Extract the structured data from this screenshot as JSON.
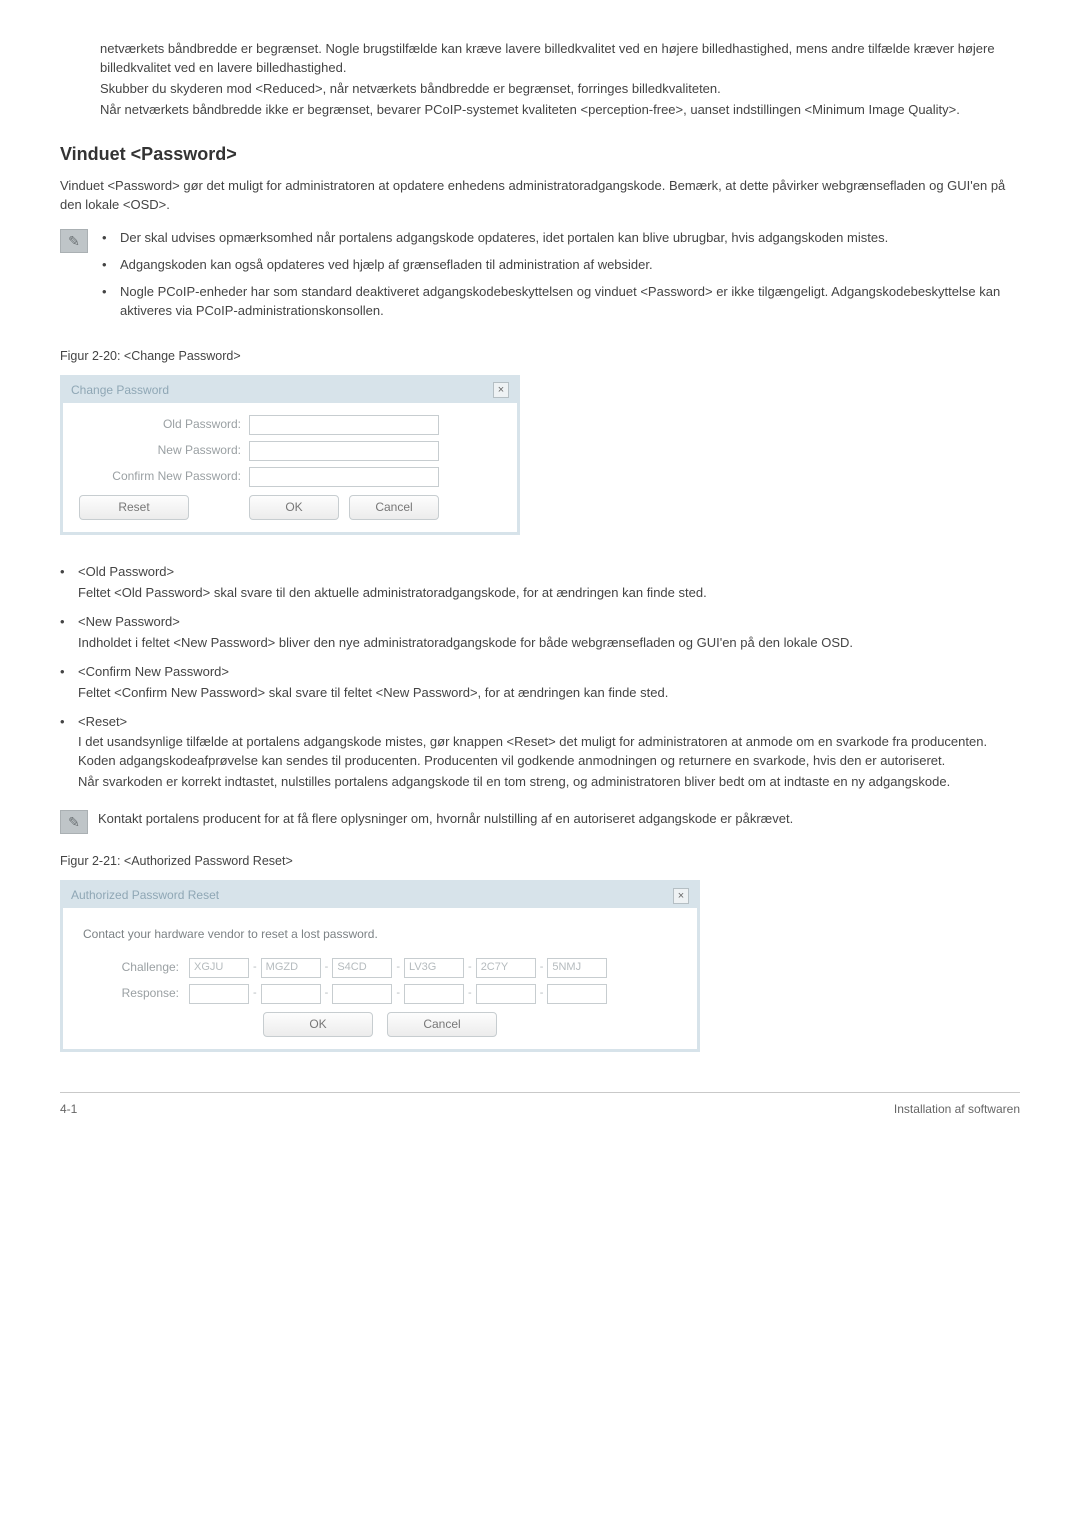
{
  "intro": {
    "p1": "netværkets båndbredde er begrænset. Nogle brugstilfælde kan kræve lavere billedkvalitet ved en højere billedhastighed, mens andre tilfælde kræver højere billedkvalitet ved en lavere billedhastighed.",
    "p2": "Skubber du skyderen mod <Reduced>, når netværkets båndbredde er begrænset, forringes billedkvaliteten.",
    "p3": "Når netværkets båndbredde ikke er begrænset, bevarer PCoIP-systemet kvaliteten <perception-free>, uanset indstillingen <Minimum Image Quality>."
  },
  "heading": "Vinduet <Password>",
  "section_intro": "Vinduet <Password> gør det muligt for administratoren at opdatere enhedens administratoradgangskode. Bemærk, at dette påvirker webgrænsefladen og GUI'en på den lokale <OSD>.",
  "notes": [
    "Der skal udvises opmærksomhed når portalens adgangskode opdateres, idet portalen kan blive ubrugbar, hvis adgangskoden mistes.",
    "Adgangskoden kan også opdateres ved hjælp af grænsefladen til administration af websider.",
    "Nogle PCoIP-enheder har som standard deaktiveret adgangskodebeskyttelsen og vinduet <Password> er ikke tilgængeligt. Adgangskodebeskyttelse kan aktiveres via PCoIP-administrationskonsollen."
  ],
  "fig220_caption": "Figur 2-20: <Change Password>",
  "change_pw_dialog": {
    "title": "Change Password",
    "close": "×",
    "labels": {
      "old": "Old Password:",
      "new": "New Password:",
      "confirm": "Confirm New Password:"
    },
    "buttons": {
      "reset": "Reset",
      "ok": "OK",
      "cancel": "Cancel"
    }
  },
  "desc": [
    {
      "term": "<Old Password>",
      "body": "Feltet <Old Password> skal svare til den aktuelle administratoradgangskode, for at ændringen kan finde sted."
    },
    {
      "term": "<New Password>",
      "body": "Indholdet i feltet <New Password> bliver den nye administratoradgangskode for både webgrænsefladen og GUI'en på den lokale OSD."
    },
    {
      "term": "<Confirm New Password>",
      "body": "Feltet <Confirm New Password> skal svare til feltet <New Password>, for at ændringen kan finde sted."
    },
    {
      "term": "<Reset>",
      "body": "I det usandsynlige tilfælde at portalens adgangskode mistes, gør knappen <Reset> det muligt for administratoren at anmode om en svarkode fra producenten. Koden adgangskodeafprøvelse kan sendes til producenten. Producenten vil godkende anmodningen og returnere en svarkode, hvis den er autoriseret.",
      "body2": "Når svarkoden er korrekt indtastet, nulstilles portalens adgangskode til en tom streng, og administratoren bliver bedt om at indtaste en ny adgangskode."
    }
  ],
  "note2": "Kontakt portalens producent for at få flere oplysninger om, hvornår nulstilling af en autoriseret adgangskode er påkrævet.",
  "fig221_caption": "Figur 2-21: <Authorized Password Reset>",
  "apr_dialog": {
    "title": "Authorized Password Reset",
    "close": "×",
    "intro": "Contact your hardware vendor to reset a lost password.",
    "labels": {
      "challenge": "Challenge:",
      "response": "Response:"
    },
    "challenge_segments": [
      "XGJU",
      "MGZD",
      "S4CD",
      "LV3G",
      "2C7Y",
      "5NMJ"
    ],
    "dash": "-",
    "buttons": {
      "ok": "OK",
      "cancel": "Cancel"
    }
  },
  "footer": {
    "left": "4-1",
    "right": "Installation af softwaren"
  },
  "icons": {
    "note": "✎"
  }
}
